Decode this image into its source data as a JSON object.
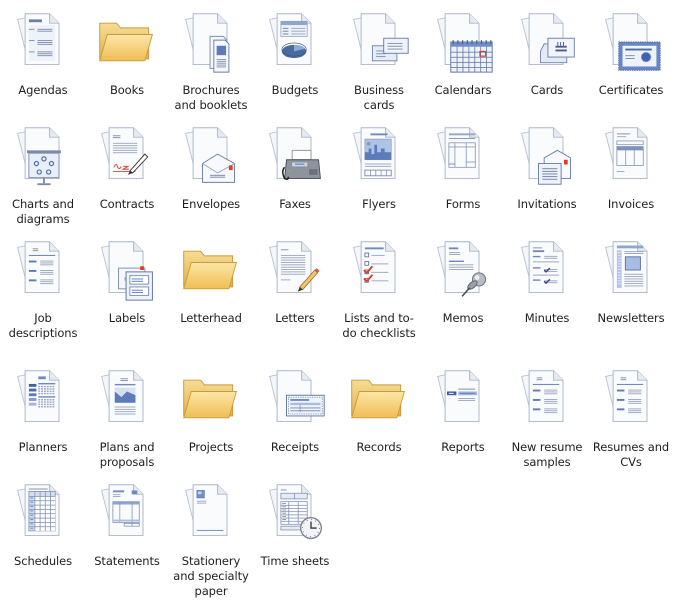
{
  "view": "large-icons",
  "colors": {
    "folder": "#f2c96a",
    "accent_blue": "#5a78b4",
    "accent_red": "#e03c28",
    "label_text": "#1e1e1e",
    "background": "#ffffff"
  },
  "items": [
    {
      "label": "Agendas",
      "icon": "agenda-icon"
    },
    {
      "label": "Books",
      "icon": "folder-icon"
    },
    {
      "label": "Brochures and booklets",
      "icon": "brochure-icon"
    },
    {
      "label": "Budgets",
      "icon": "budget-icon"
    },
    {
      "label": "Business cards",
      "icon": "business-card-icon"
    },
    {
      "label": "Calendars",
      "icon": "calendar-icon"
    },
    {
      "label": "Cards",
      "icon": "card-icon"
    },
    {
      "label": "Certificates",
      "icon": "certificate-icon"
    },
    {
      "label": "Charts and diagrams",
      "icon": "chart-diagram-icon"
    },
    {
      "label": "Contracts",
      "icon": "contract-icon"
    },
    {
      "label": "Envelopes",
      "icon": "envelope-icon"
    },
    {
      "label": "Faxes",
      "icon": "fax-icon"
    },
    {
      "label": "Flyers",
      "icon": "flyer-icon"
    },
    {
      "label": "Forms",
      "icon": "form-icon"
    },
    {
      "label": "Invitations",
      "icon": "invitation-icon"
    },
    {
      "label": "Invoices",
      "icon": "invoice-icon"
    },
    {
      "label": "Job descriptions",
      "icon": "job-description-icon"
    },
    {
      "label": "Labels",
      "icon": "label-icon"
    },
    {
      "label": "Letterhead",
      "icon": "folder-icon"
    },
    {
      "label": "Letters",
      "icon": "letter-icon"
    },
    {
      "label": "Lists and to-do checklists",
      "icon": "checklist-icon"
    },
    {
      "label": "Memos",
      "icon": "memo-icon"
    },
    {
      "label": "Minutes",
      "icon": "minutes-icon"
    },
    {
      "label": "Newsletters",
      "icon": "newsletter-icon"
    },
    {
      "label": "Planners",
      "icon": "planner-icon"
    },
    {
      "label": "Plans and proposals",
      "icon": "proposal-icon"
    },
    {
      "label": "Projects",
      "icon": "folder-icon"
    },
    {
      "label": "Receipts",
      "icon": "receipt-icon"
    },
    {
      "label": "Records",
      "icon": "folder-icon"
    },
    {
      "label": "Reports",
      "icon": "report-icon"
    },
    {
      "label": "New resume samples",
      "icon": "resume-icon"
    },
    {
      "label": "Resumes and CVs",
      "icon": "resume-icon"
    },
    {
      "label": "Schedules",
      "icon": "schedule-icon"
    },
    {
      "label": "Statements",
      "icon": "statement-icon"
    },
    {
      "label": "Stationery and specialty paper",
      "icon": "stationery-icon"
    },
    {
      "label": "Time sheets",
      "icon": "timesheet-icon"
    }
  ]
}
